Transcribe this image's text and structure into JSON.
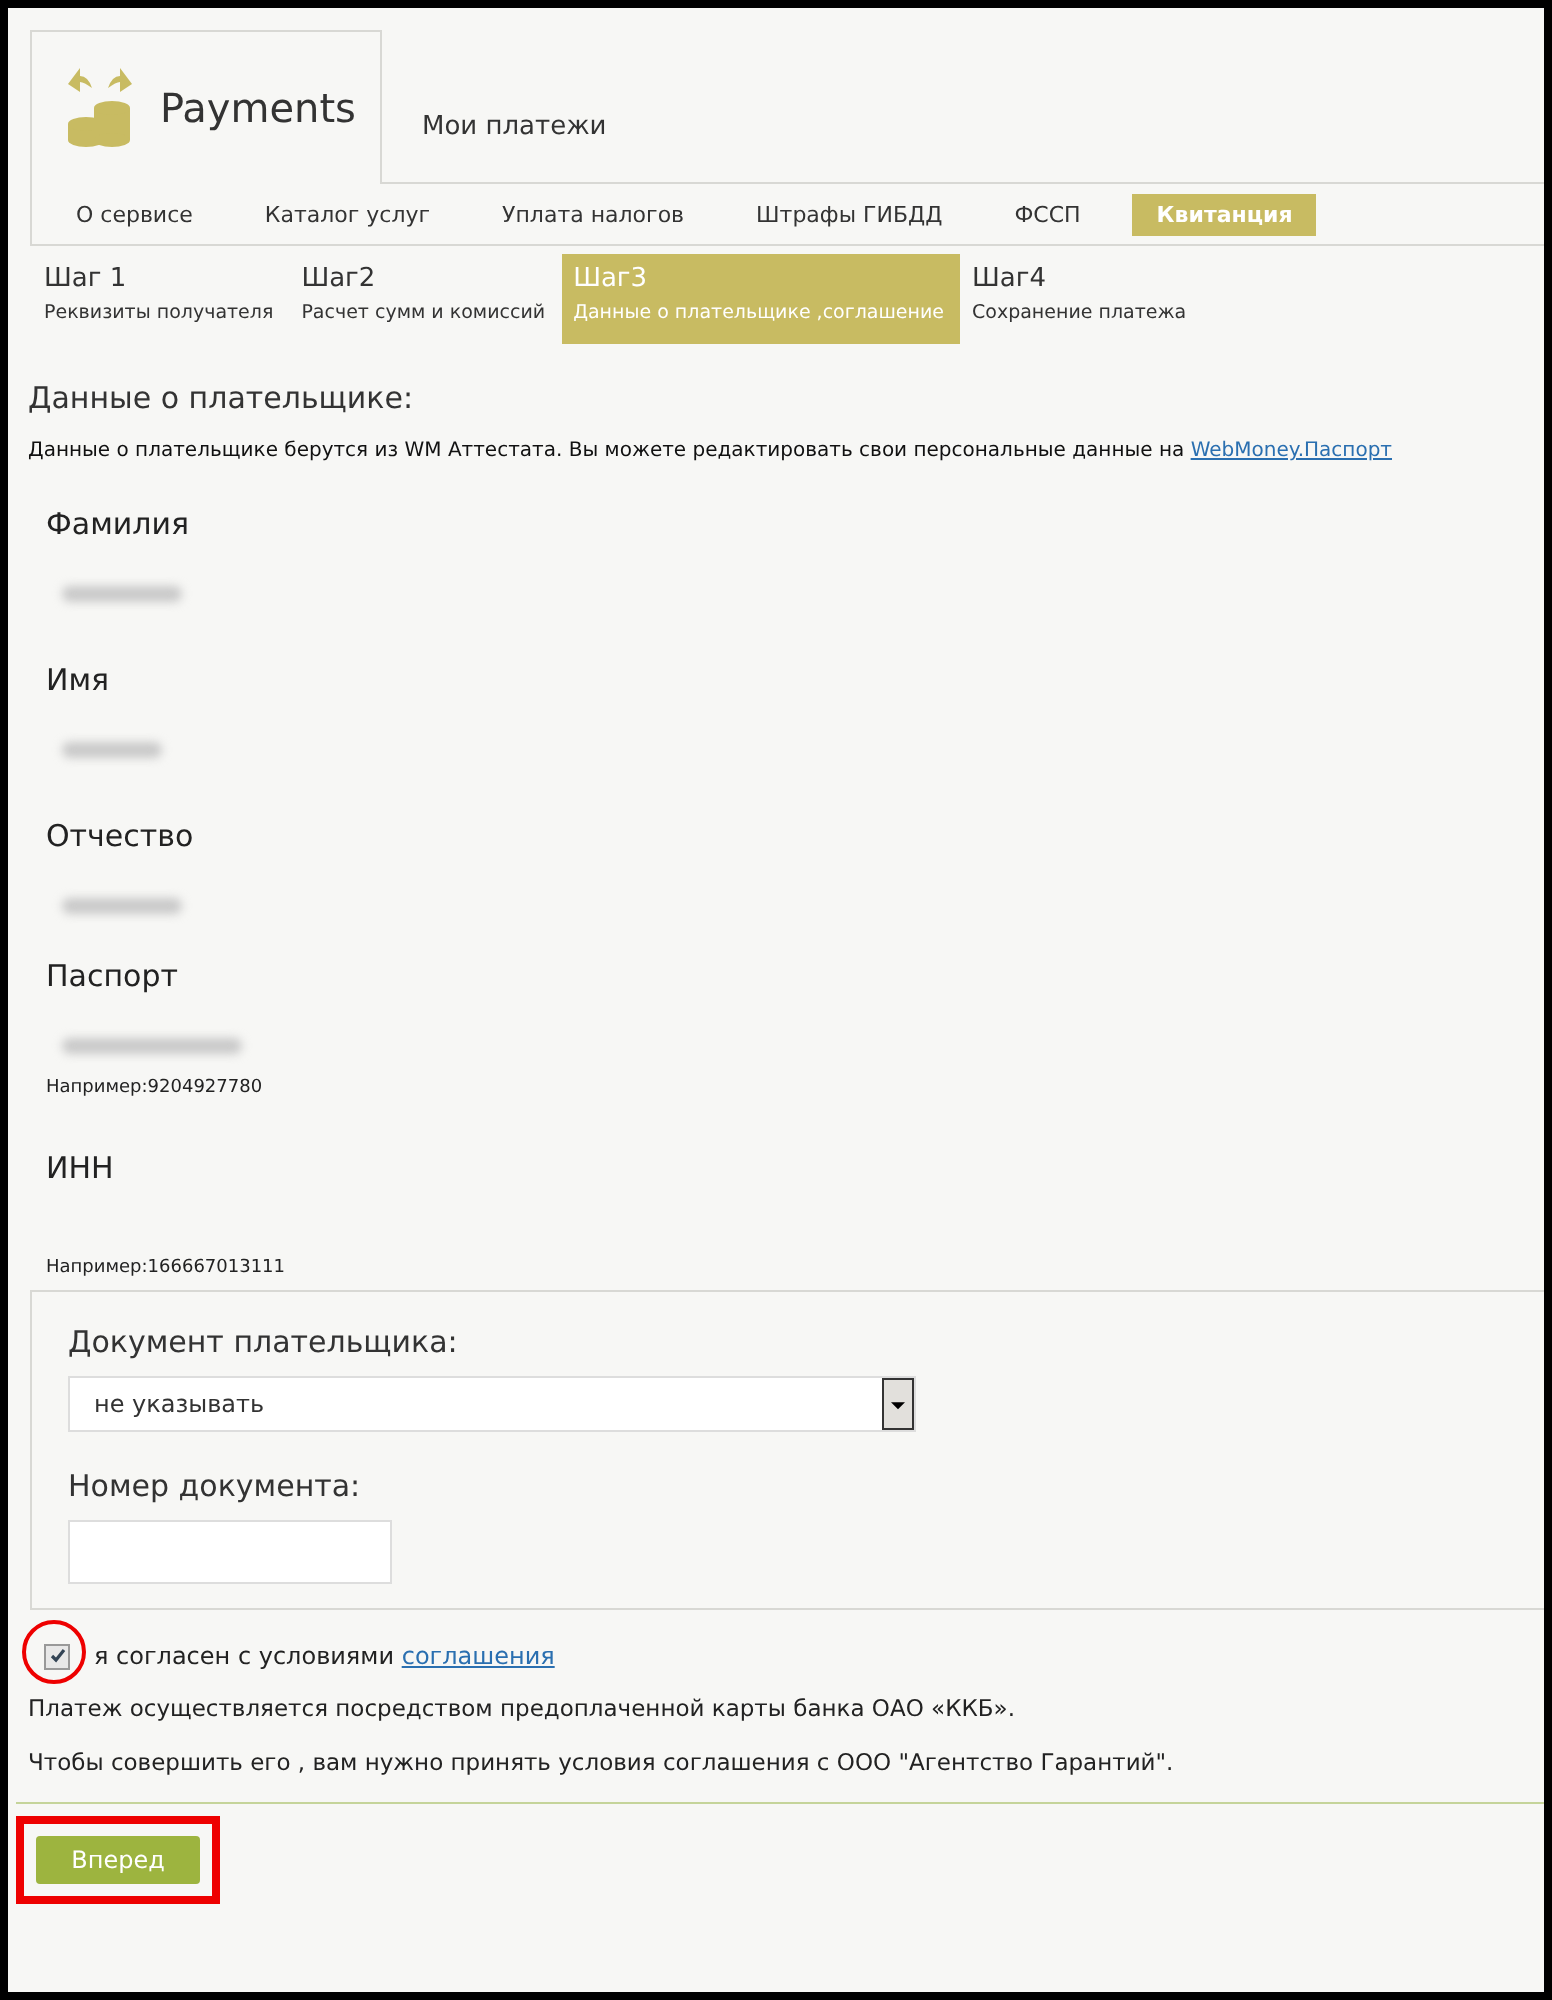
{
  "header": {
    "tabs": [
      {
        "label": "Payments",
        "selected": true
      },
      {
        "label": "Мои платежи",
        "selected": false
      }
    ]
  },
  "nav": [
    {
      "label": "О сервисе",
      "selected": false
    },
    {
      "label": "Каталог услуг",
      "selected": false
    },
    {
      "label": "Уплата налогов",
      "selected": false
    },
    {
      "label": "Штрафы ГИБДД",
      "selected": false
    },
    {
      "label": "ФССП",
      "selected": false
    },
    {
      "label": "Квитанция",
      "selected": true
    }
  ],
  "steps": [
    {
      "title": "Шаг 1",
      "subtitle": "Реквизиты получателя",
      "selected": false
    },
    {
      "title": "Шаг2",
      "subtitle": "Расчет сумм и комиссий",
      "selected": false
    },
    {
      "title": "Шаг3",
      "subtitle": "Данные о плательщике ,соглашение",
      "selected": true
    },
    {
      "title": "Шаг4",
      "subtitle": "Сохранение платежа",
      "selected": false
    }
  ],
  "section_title": "Данные о плательщике:",
  "info": {
    "text": "Данные о плательщике берутся из WM Аттестата. Вы можете редактировать свои персональные данные на",
    "link": "WebMoney.Паспорт"
  },
  "fields": [
    {
      "label": "Фамилия",
      "redacted": true
    },
    {
      "label": "Имя",
      "redacted": true
    },
    {
      "label": "Отчество",
      "redacted": true
    },
    {
      "label": "Паспорт",
      "redacted": true,
      "hint": "Например:9204927780"
    },
    {
      "label": "ИНН",
      "redacted": false,
      "hint": "Например:166667013111"
    }
  ],
  "document": {
    "type_label": "Документ плательщика:",
    "type_value": "не указывать",
    "number_label": "Номер документа:"
  },
  "agreement": {
    "checked": true,
    "annotated": true,
    "text": "я согласен с условиями",
    "link": "соглашения"
  },
  "notes": [
    "Платеж осуществляется посредством предоплаченной карты банка ОАО «ККБ».",
    "Чтобы совершить его , вам нужно принять условия соглашения с ООО \"Агентство Гарантий\"."
  ],
  "submit": {
    "label": "Вперед",
    "annotated": true
  }
}
